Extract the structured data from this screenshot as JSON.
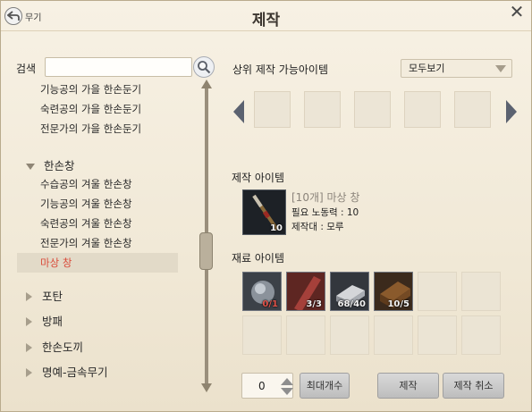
{
  "window": {
    "title": "제작",
    "back_label": "무기"
  },
  "search": {
    "label": "검색",
    "value": "",
    "placeholder": ""
  },
  "tree": {
    "items": [
      {
        "label": "기능공의 가을 한손둔기",
        "type": "sub"
      },
      {
        "label": "숙련공의 가을 한손둔기",
        "type": "sub"
      },
      {
        "label": "전문가의 가을 한손둔기",
        "type": "sub"
      },
      {
        "label": "한손창",
        "type": "head",
        "expanded": true
      },
      {
        "label": "수습공의 겨울 한손창",
        "type": "sub"
      },
      {
        "label": "기능공의 겨울 한손창",
        "type": "sub"
      },
      {
        "label": "숙련공의 겨울 한손창",
        "type": "sub"
      },
      {
        "label": "전문가의 겨울 한손창",
        "type": "sub"
      },
      {
        "label": "마상 창",
        "type": "sub",
        "selected": true
      },
      {
        "label": "포탄",
        "type": "head",
        "expanded": false
      },
      {
        "label": "방패",
        "type": "head",
        "expanded": false
      },
      {
        "label": "한손도끼",
        "type": "head",
        "expanded": false
      },
      {
        "label": "명예-금속무기",
        "type": "head",
        "expanded": false
      }
    ]
  },
  "upper": {
    "title": "상위 제작 가능아이템",
    "filter": "모두보기",
    "slots": 5
  },
  "craft_item": {
    "title": "제작 아이템",
    "name": "[10개] 마상 창",
    "count": "10",
    "labor": "필요 노동력 : 10",
    "bench": "제작대 : 모루"
  },
  "materials": {
    "title": "재료 아이템",
    "items": [
      {
        "icon": "crystal-icon",
        "count": "0/1",
        "lack": true
      },
      {
        "icon": "wood-plank-icon",
        "count": "3/3",
        "lack": false
      },
      {
        "icon": "iron-ingot-icon",
        "count": "68/40",
        "lack": false
      },
      {
        "icon": "lumber-bundle-icon",
        "count": "10/5",
        "lack": false
      }
    ],
    "total_slots": 12
  },
  "actions": {
    "quantity": "0",
    "max_label": "최대개수",
    "craft_label": "제작",
    "cancel_label": "제작 취소"
  }
}
